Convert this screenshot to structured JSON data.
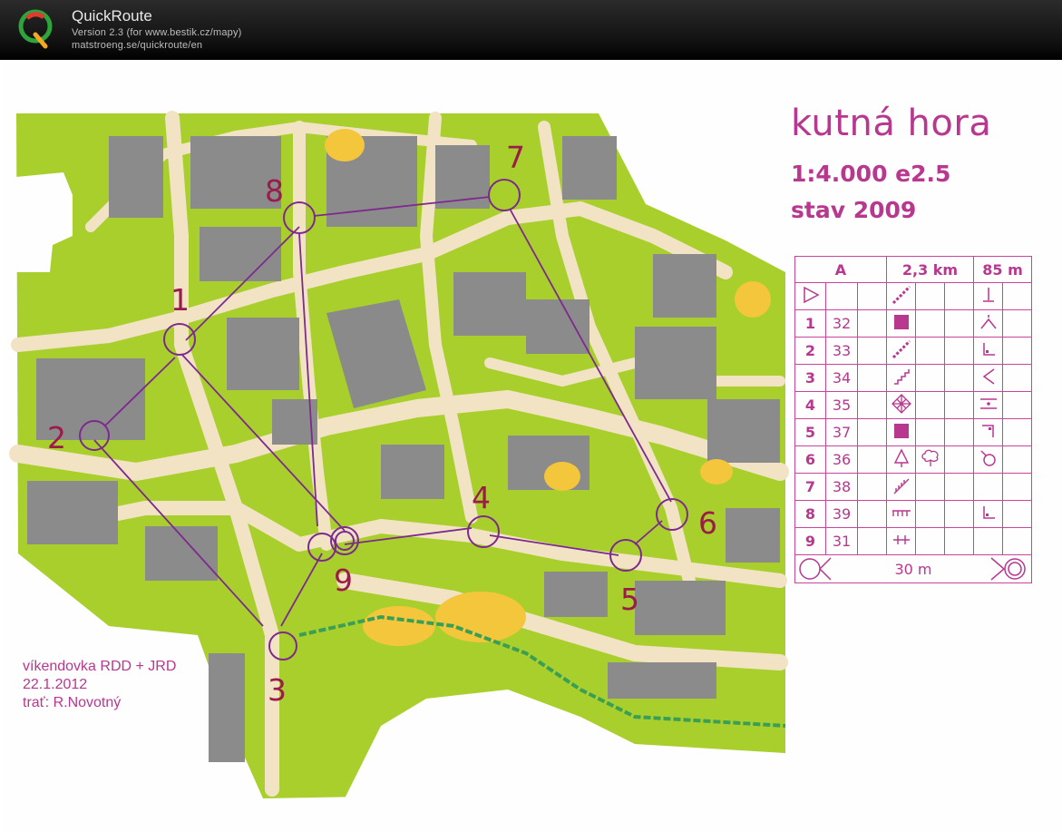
{
  "app": {
    "name": "QuickRoute",
    "version": "Version 2.3  (for www.bestik.cz/mapy)",
    "url": "matstroeng.se/quickroute/en"
  },
  "map": {
    "title": "kutná hora",
    "scale": "1:4.000  e2.5",
    "status": "stav 2009",
    "event_lines": [
      "víkendovka RDD + JRD",
      "22.1.2012",
      "trať: R.Novotný"
    ],
    "controls": [
      {
        "num": "1",
        "label": "1"
      },
      {
        "num": "2",
        "label": "2"
      },
      {
        "num": "3",
        "label": "3"
      },
      {
        "num": "4",
        "label": "4"
      },
      {
        "num": "5",
        "label": "5"
      },
      {
        "num": "6",
        "label": "6"
      },
      {
        "num": "7",
        "label": "7"
      },
      {
        "num": "8",
        "label": "8"
      },
      {
        "num": "9",
        "label": "9"
      }
    ]
  },
  "description": {
    "header": {
      "course": "A",
      "length": "2,3 km",
      "climb": "85 m"
    },
    "rows": [
      {
        "num": "",
        "code": "",
        "feature_icon": "start-triangle-icon",
        "symbol": "stairs-diagonal-icon",
        "extra": "",
        "position": "foot-bottom-icon"
      },
      {
        "num": "1",
        "code": "32",
        "symbol": "building-square-icon",
        "extra": "",
        "position": "top-corner-icon"
      },
      {
        "num": "2",
        "code": "33",
        "symbol": "stairs-diagonal-icon",
        "extra": "",
        "position": "bottom-left-corner-icon"
      },
      {
        "num": "3",
        "code": "34",
        "symbol": "stairs-step-icon",
        "extra": "",
        "position": "left-angle-icon"
      },
      {
        "num": "4",
        "code": "35",
        "symbol": "crosshatch-icon",
        "extra": "",
        "position": "middle-icon"
      },
      {
        "num": "5",
        "code": "37",
        "symbol": "building-square-icon",
        "extra": "",
        "position": "top-right-corner-icon"
      },
      {
        "num": "6",
        "code": "36",
        "symbol": "conifer-tree-icon",
        "extra": "deciduous-tree-icon",
        "position": "circle-part-icon"
      },
      {
        "num": "7",
        "code": "38",
        "symbol": "ramp-icon",
        "extra": "",
        "position": "ramp-line-icon"
      },
      {
        "num": "8",
        "code": "39",
        "symbol": "fence-icon",
        "extra": "",
        "position": "corner-bottom-icon"
      },
      {
        "num": "9",
        "code": "31",
        "symbol": "passage-icon",
        "extra": "",
        "position": ""
      }
    ],
    "footer": "30 m"
  },
  "colors": {
    "purple": "#b8378f",
    "route": "#7d2a8e",
    "green": "#a7cf2a",
    "building": "#8a8a8a",
    "street": "#f3e6c8",
    "yellow": "#f4c63b"
  }
}
